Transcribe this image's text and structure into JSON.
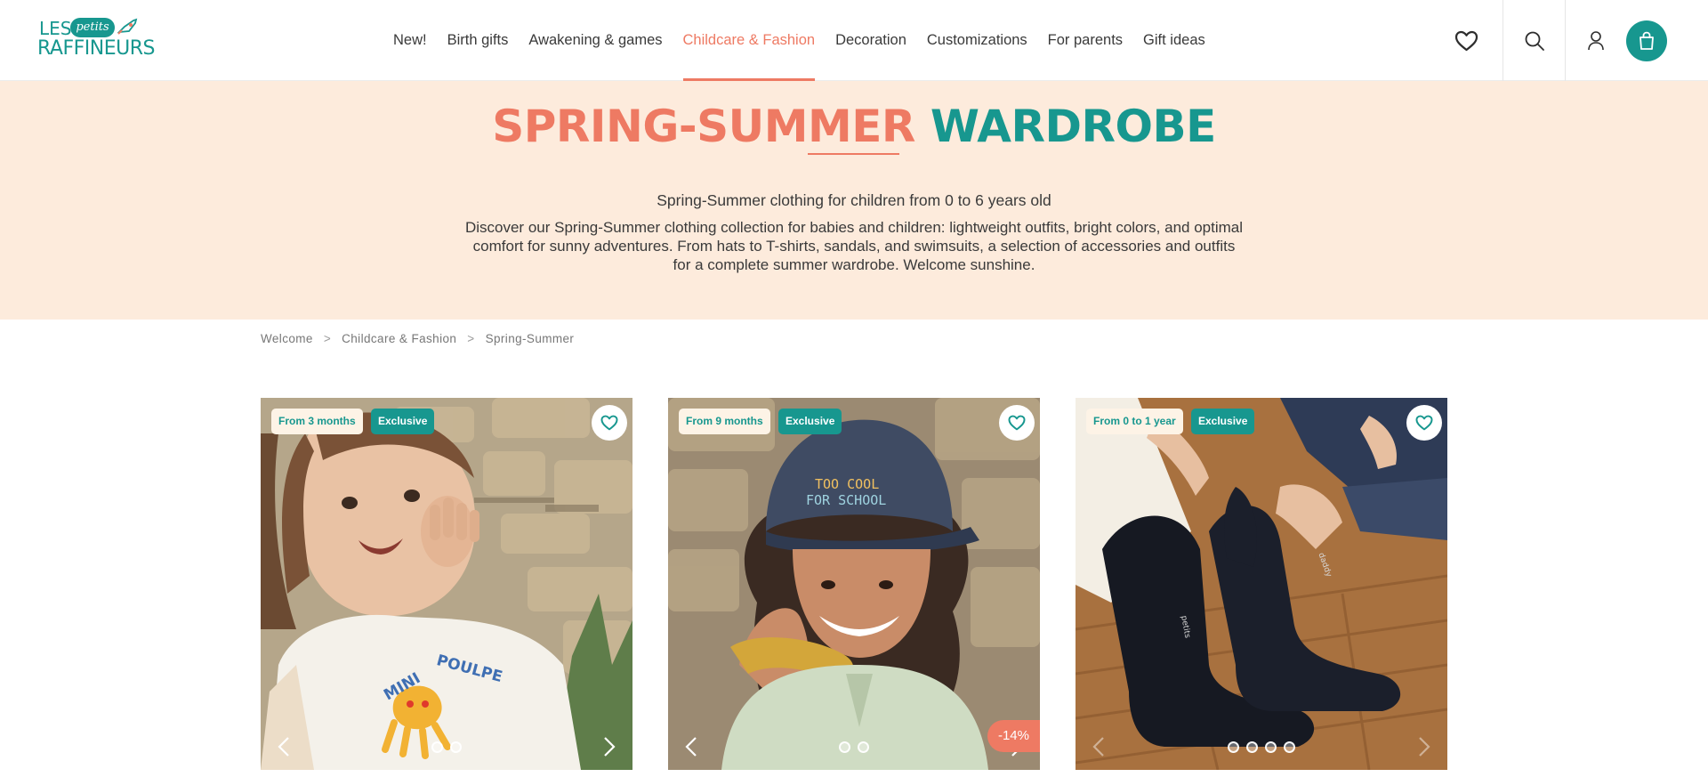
{
  "brand": {
    "line1": "LES",
    "tag": "petits",
    "line2": "RAFFINEURS",
    "color_teal": "#17978f",
    "color_coral": "#ee7a63"
  },
  "nav": {
    "items": [
      "New!",
      "Birth gifts",
      "Awakening & games",
      "Childcare & Fashion",
      "Decoration",
      "Customizations",
      "For parents",
      "Gift ideas"
    ],
    "active": "Childcare & Fashion"
  },
  "header_icons": [
    "heart-icon",
    "search-icon",
    "user-icon",
    "shopping-bag-icon"
  ],
  "hero": {
    "title_part1": "SPRING-SUMMER",
    "title_part2": "WARDROBE",
    "subtitle": "Spring-Summer clothing for children from 0 to 6 years old",
    "description": "Discover our Spring-Summer clothing collection for babies and children: lightweight outfits, bright colors, and optimal comfort for sunny adventures. From hats to T-shirts, sandals, and swimsuits, a selection of accessories and outfits for a complete summer wardrobe. Welcome sunshine.",
    "background": "#fdebdc"
  },
  "breadcrumb": [
    "Welcome",
    "Childcare & Fashion",
    "Spring-Summer"
  ],
  "breadcrumb_separator": ">",
  "products": [
    {
      "age_badge": "From 3 months",
      "excl_badge": "Exclusive",
      "image_dots": 2,
      "active_dot": 0,
      "photo": "girl-in-white-tshirt-octopus",
      "discount": ""
    },
    {
      "age_badge": "From 9 months",
      "excl_badge": "Exclusive",
      "image_dots": 2,
      "active_dot": 0,
      "photo": "boy-in-navy-cap-too-cool-for-school",
      "cap_text_1": "TOO COOL",
      "cap_text_2": "FOR SCHOOL",
      "discount": "-14%"
    },
    {
      "age_badge": "From 0 to 1 year",
      "excl_badge": "Exclusive",
      "image_dots": 4,
      "active_dot": 0,
      "photo": "black-socks-on-wooden-floor",
      "discount": ""
    }
  ]
}
